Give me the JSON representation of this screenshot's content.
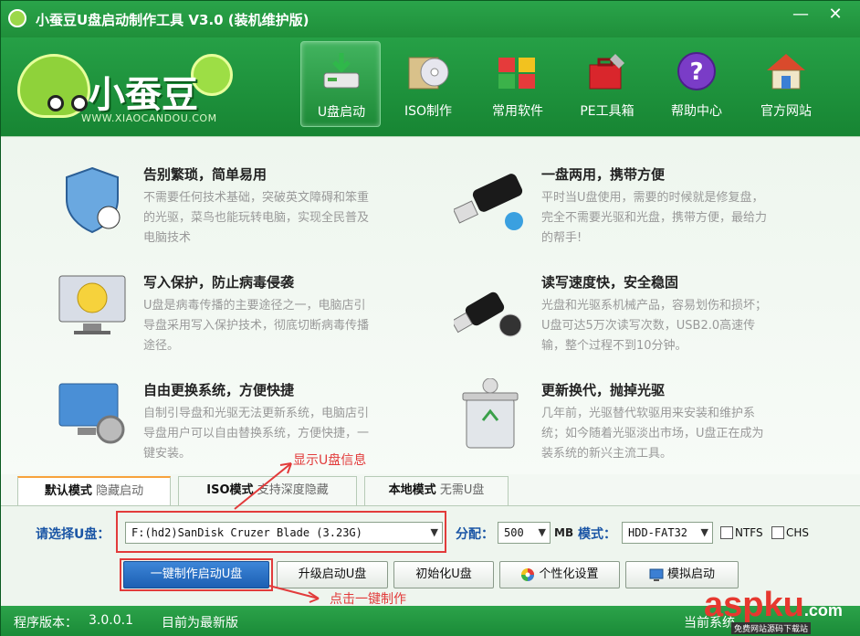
{
  "window": {
    "title": "小蚕豆U盘启动制作工具 V3.0 (装机维护版)",
    "minimize": "—",
    "close": "✕"
  },
  "logo": {
    "text": "小蚕豆",
    "url": "WWW.XIAOCANDOU.COM"
  },
  "toolbar": [
    {
      "label": "U盘启动",
      "icon": "usb-drive-icon"
    },
    {
      "label": "ISO制作",
      "icon": "disc-folder-icon"
    },
    {
      "label": "常用软件",
      "icon": "cubes-icon"
    },
    {
      "label": "PE工具箱",
      "icon": "toolbox-icon"
    },
    {
      "label": "帮助中心",
      "icon": "help-icon"
    },
    {
      "label": "官方网站",
      "icon": "house-icon"
    }
  ],
  "features": [
    {
      "title": "告别繁琐，简单易用",
      "desc": "不需要任何技术基础，突破英文障碍和笨重的光驱，菜鸟也能玩转电脑，实现全民普及电脑技术",
      "icon": "shield-icon"
    },
    {
      "title": "一盘两用，携带方便",
      "desc": "平时当U盘使用，需要的时候就是修复盘，完全不需要光驱和光盘，携带方便，最给力的帮手!",
      "icon": "usb-stick-icon"
    },
    {
      "title": "写入保护，防止病毒侵袭",
      "desc": "U盘是病毒传播的主要途径之一，电脑店引导盘采用写入保护技术，彻底切断病毒传播途径。",
      "icon": "monitor-smile-icon"
    },
    {
      "title": "读写速度快，安全稳固",
      "desc": "光盘和光驱系机械产品，容易划伤和损坏；U盘可达5万次读写次数，USB2.0高速传输，整个过程不到10分钟。",
      "icon": "usb-plug-icon"
    },
    {
      "title": "自由更换系统，方便快捷",
      "desc": "自制引导盘和光驱无法更新系统，电脑店引导盘用户可以自由替换系统，方便快捷，一键安装。",
      "icon": "monitor-gear-icon"
    },
    {
      "title": "更新换代，抛掉光驱",
      "desc": "几年前，光驱替代软驱用来安装和维护系统；如今随着光驱淡出市场，U盘正在成为装系统的新兴主流工具。",
      "icon": "recycle-bin-icon"
    }
  ],
  "tabs": [
    {
      "main": "默认模式",
      "sub": "隐藏启动"
    },
    {
      "main": "ISO模式",
      "sub": "支持深度隐藏"
    },
    {
      "main": "本地模式",
      "sub": "无需U盘"
    }
  ],
  "panel": {
    "select_label": "请选择U盘：",
    "usb_value": "F:(hd2)SanDisk Cruzer Blade (3.23G)",
    "alloc_label": "分配：",
    "alloc_value": "500",
    "alloc_unit": "MB",
    "mode_label": "模式：",
    "mode_value": "HDD-FAT32",
    "ntfs_label": "NTFS",
    "chs_label": "CHS"
  },
  "buttons": {
    "make": "一键制作启动U盘",
    "upgrade": "升级启动U盘",
    "init": "初始化U盘",
    "custom": "个性化设置",
    "simulate": "模拟启动"
  },
  "annotations": {
    "show_info": "显示U盘信息",
    "click_make": "点击一键制作"
  },
  "status": {
    "version_label": "程序版本：",
    "version": "3.0.0.1",
    "latest": "目前为最新版",
    "current_sys": "当前系统"
  },
  "watermark": {
    "brand": "aspku",
    "suffix": ".com",
    "sub": "免费网站源码下载站"
  },
  "colors": {
    "titlebar": "#1f8f3a",
    "accent": "#f7a23c",
    "primary_button": "#1c5fb3",
    "annotation": "#e23b3b"
  }
}
